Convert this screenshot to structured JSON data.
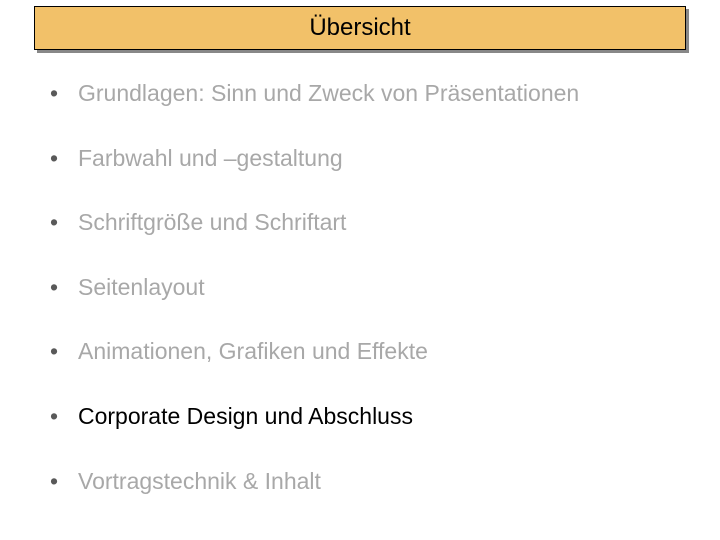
{
  "title": "Übersicht",
  "bullets": {
    "b0": "Grundlagen: Sinn und Zweck von Präsentationen",
    "b1": "Farbwahl und –gestaltung",
    "b2": "Schriftgröße und Schriftart",
    "b3": "Seitenlayout",
    "b4": "Animationen, Grafiken und Effekte",
    "b5": "Corporate Design und Abschluss",
    "b6": "Vortragstechnik & Inhalt"
  },
  "dot": "•"
}
